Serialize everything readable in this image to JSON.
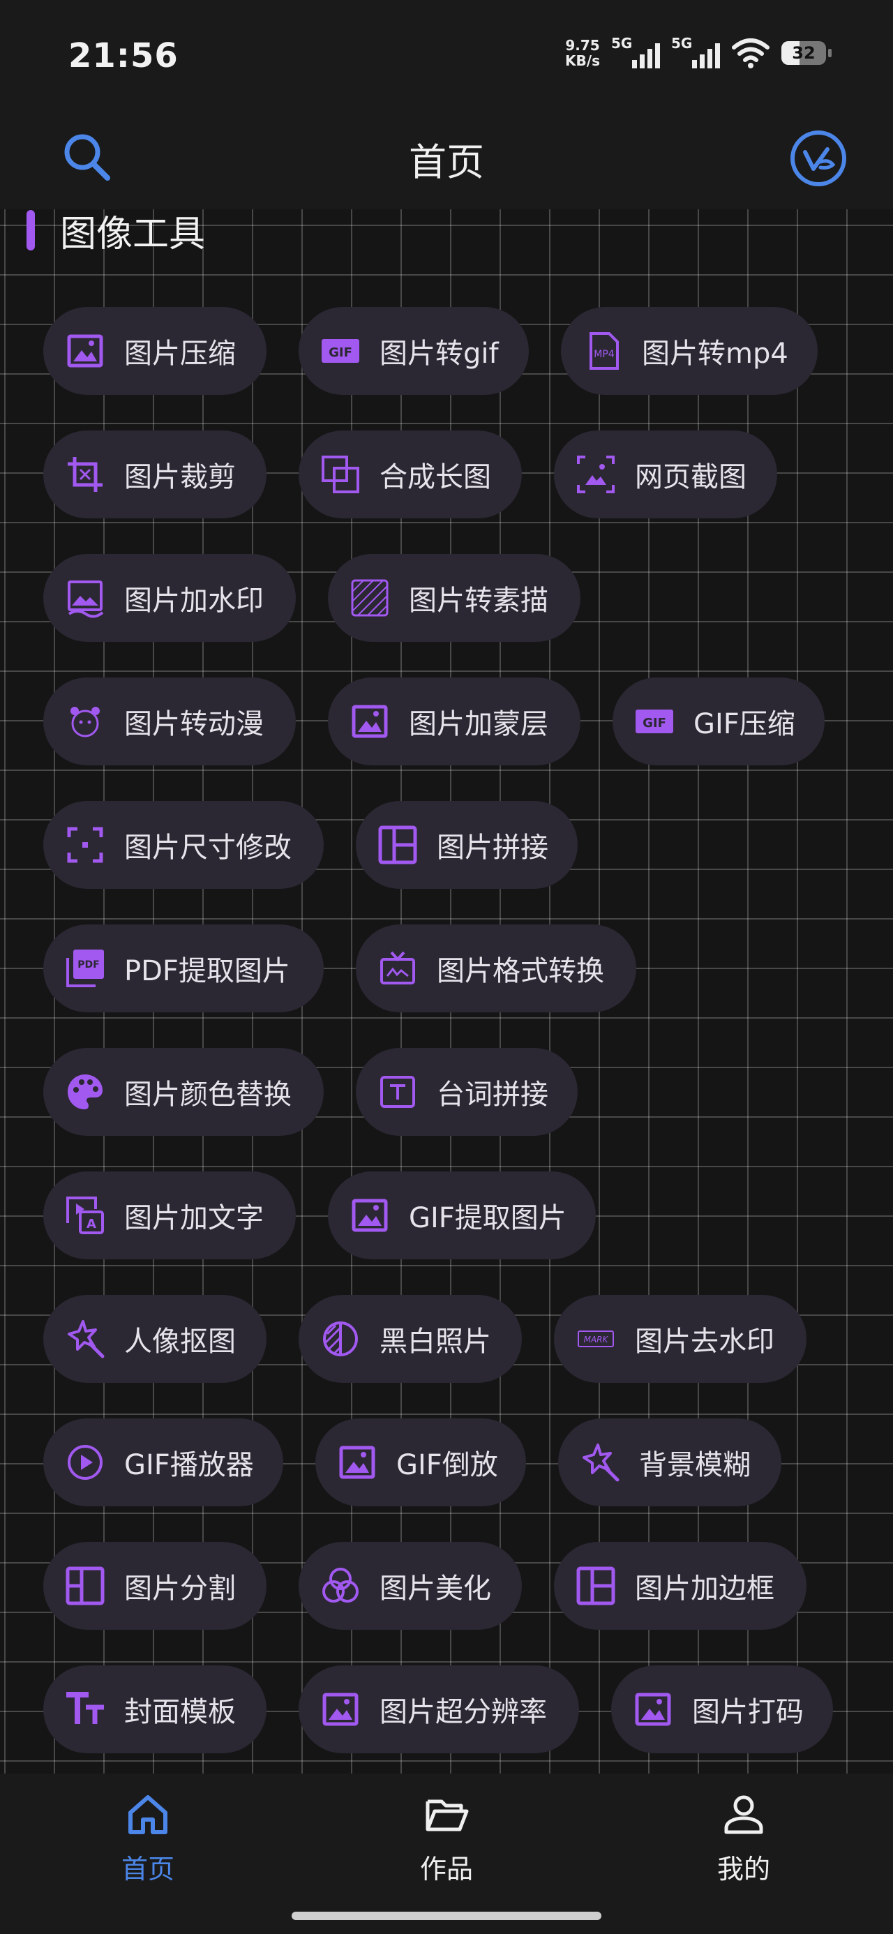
{
  "status_bar": {
    "time": "21:56",
    "net_speed_value": "9.75",
    "net_speed_unit": "KB/s",
    "sim1_label": "5G",
    "sim2_label": "5G",
    "battery": "32"
  },
  "header": {
    "title": "首页",
    "search_icon": "search-icon",
    "vip_icon": "vip-badge-icon"
  },
  "section": {
    "title": "图像工具"
  },
  "accent_color": "#a159f0",
  "tools": [
    [
      {
        "label": "图片压缩",
        "icon": "image-icon"
      },
      {
        "label": "图片转gif",
        "icon": "gif-icon"
      },
      {
        "label": "图片转mp4",
        "icon": "mp4-file-icon"
      }
    ],
    [
      {
        "label": "图片裁剪",
        "icon": "crop-icon"
      },
      {
        "label": "合成长图",
        "icon": "layers-icon"
      },
      {
        "label": "网页截图",
        "icon": "screenshot-icon"
      }
    ],
    [
      {
        "label": "图片加水印",
        "icon": "watermark-image-icon"
      },
      {
        "label": "图片转素描",
        "icon": "sketch-pattern-icon"
      }
    ],
    [
      {
        "label": "图片转动漫",
        "icon": "anime-face-icon"
      },
      {
        "label": "图片加蒙层",
        "icon": "image-icon"
      },
      {
        "label": "GIF压缩",
        "icon": "gif-icon"
      }
    ],
    [
      {
        "label": "图片尺寸修改",
        "icon": "resize-frame-icon"
      },
      {
        "label": "图片拼接",
        "icon": "collage-layout-icon"
      }
    ],
    [
      {
        "label": "PDF提取图片",
        "icon": "pdf-icon"
      },
      {
        "label": "图片格式转换",
        "icon": "format-convert-icon"
      }
    ],
    [
      {
        "label": "图片颜色替换",
        "icon": "palette-icon"
      },
      {
        "label": "台词拼接",
        "icon": "text-box-icon"
      }
    ],
    [
      {
        "label": "图片加文字",
        "icon": "image-text-icon"
      },
      {
        "label": "GIF提取图片",
        "icon": "image-icon"
      }
    ],
    [
      {
        "label": "人像抠图",
        "icon": "magic-wand-icon"
      },
      {
        "label": "黑白照片",
        "icon": "contrast-icon"
      },
      {
        "label": "图片去水印",
        "icon": "mark-remove-icon"
      }
    ],
    [
      {
        "label": "GIF播放器",
        "icon": "play-circle-icon"
      },
      {
        "label": "GIF倒放",
        "icon": "image-icon"
      },
      {
        "label": "背景模糊",
        "icon": "magic-wand-icon"
      }
    ],
    [
      {
        "label": "图片分割",
        "icon": "split-layout-icon"
      },
      {
        "label": "图片美化",
        "icon": "beautify-circles-icon"
      },
      {
        "label": "图片加边框",
        "icon": "border-layout-icon"
      }
    ],
    [
      {
        "label": "封面模板",
        "icon": "font-size-icon"
      },
      {
        "label": "图片超分辨率",
        "icon": "image-icon"
      },
      {
        "label": "图片打码",
        "icon": "image-icon"
      }
    ]
  ],
  "bottom_nav": [
    {
      "label": "首页",
      "icon": "home-icon",
      "active": true
    },
    {
      "label": "作品",
      "icon": "folder-icon",
      "active": false
    },
    {
      "label": "我的",
      "icon": "user-icon",
      "active": false
    }
  ]
}
